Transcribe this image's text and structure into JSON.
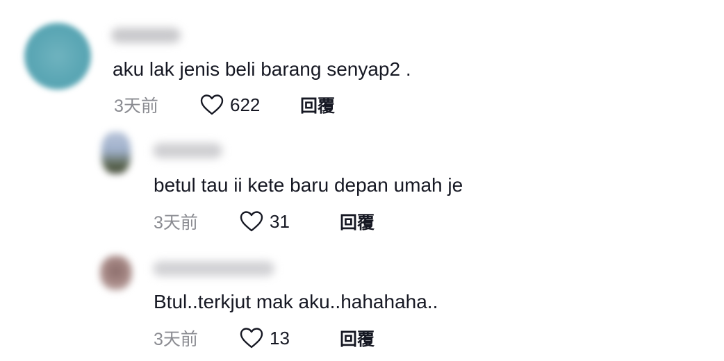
{
  "comments": [
    {
      "text": "aku lak jenis beli barang senyap2 .",
      "time": "3天前",
      "likes": "622",
      "reply_label": "回覆"
    },
    {
      "text": "betul tau ii kete baru depan umah je",
      "time": "3天前",
      "likes": "31",
      "reply_label": "回覆"
    },
    {
      "text": "Btul..terkjut mak aku..hahahaha..",
      "time": "3天前",
      "likes": "13",
      "reply_label": "回覆"
    }
  ],
  "icons": {
    "like": "heart-outline-icon"
  },
  "colors": {
    "text": "#161823",
    "muted": "#8a8b91"
  }
}
